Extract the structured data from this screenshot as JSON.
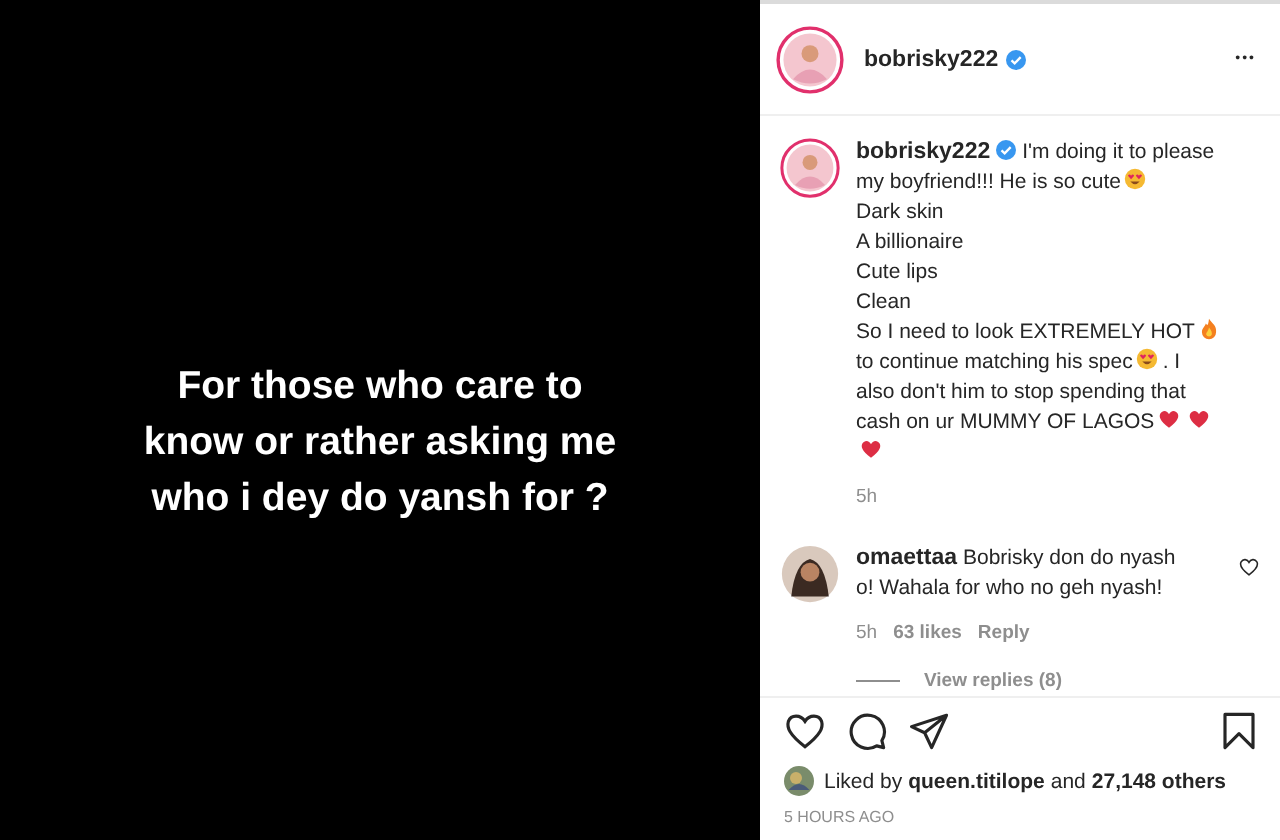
{
  "post_image": {
    "caption_lines": [
      "For those who care to",
      "know or rather asking me",
      "who i dey do yansh for ?"
    ]
  },
  "header": {
    "username": "bobrisky222",
    "verified": true,
    "more": "•••"
  },
  "caption": {
    "username": "bobrisky222",
    "verified": true,
    "lines": [
      [
        {
          "kind": "text",
          "text": "I'm doing it to please"
        }
      ],
      [
        {
          "kind": "text",
          "text": "my boyfriend!!! He is so cute"
        },
        {
          "kind": "heart-eyes"
        }
      ],
      [
        {
          "kind": "text",
          "text": "Dark skin"
        }
      ],
      [
        {
          "kind": "text",
          "text": "A billionaire"
        }
      ],
      [
        {
          "kind": "text",
          "text": "Cute lips"
        }
      ],
      [
        {
          "kind": "text",
          "text": "Clean"
        }
      ],
      [
        {
          "kind": "text",
          "text": "So I need to look EXTREMELY HOT"
        },
        {
          "kind": "fire"
        }
      ],
      [
        {
          "kind": "text",
          "text": "to continue matching his spec"
        },
        {
          "kind": "heart-eyes"
        },
        {
          "kind": "text",
          "text": ". I"
        }
      ],
      [
        {
          "kind": "text",
          "text": "also don't him to stop spending that"
        }
      ],
      [
        {
          "kind": "text",
          "text": "cash on ur MUMMY OF LAGOS"
        },
        {
          "kind": "heart"
        },
        {
          "kind": "heart"
        }
      ],
      [
        {
          "kind": "heart"
        }
      ]
    ],
    "time": "5h"
  },
  "comments": [
    {
      "username": "omaettaa",
      "lines": [
        "Bobrisky don do nyash",
        "o! Wahala for who no geh nyash!"
      ],
      "liked": false,
      "time": "5h",
      "likes": "63 likes",
      "reply": "Reply",
      "view_replies": "View replies (8)"
    }
  ],
  "actions": {
    "liked": false,
    "saved": false
  },
  "likes": {
    "prefix": "Liked by",
    "user": "queen.titilope",
    "suffix": "and",
    "count": "27,148 others"
  },
  "timestamp": "5 HOURS AGO"
}
